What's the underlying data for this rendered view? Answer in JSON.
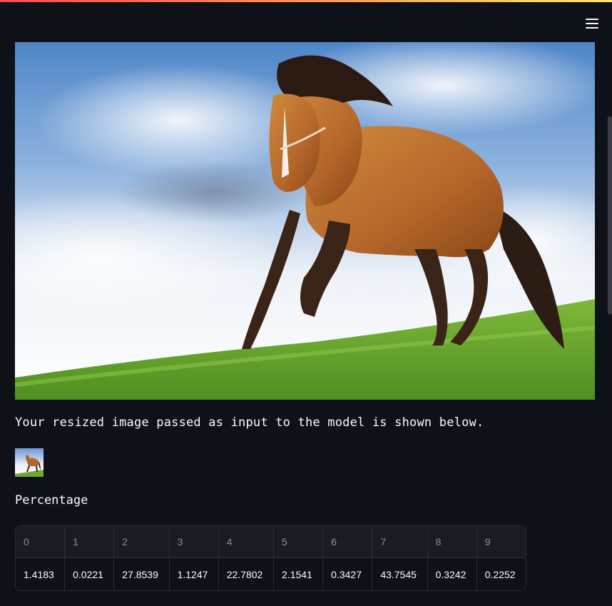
{
  "caption": "Your resized image passed as input to the model is shown below.",
  "section_label": "Percentage",
  "table": {
    "headers": [
      "0",
      "1",
      "2",
      "3",
      "4",
      "5",
      "6",
      "7",
      "8",
      "9"
    ],
    "values": [
      "1.4183",
      "0.0221",
      "27.8539",
      "1.1247",
      "22.7802",
      "2.1541",
      "0.3427",
      "43.7545",
      "0.3242",
      "0.2252"
    ]
  },
  "icons": {
    "menu": "hamburger-menu-icon"
  },
  "colors": {
    "background": "#0e1117",
    "accent_gradient_start": "#ff4b4b",
    "accent_gradient_end": "#ffe46e"
  }
}
